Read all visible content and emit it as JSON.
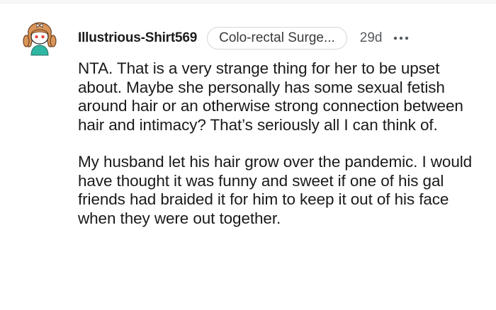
{
  "comment": {
    "author": {
      "username": "Illustrious-Shirt569",
      "avatar_icon": "snoo-avatar-icon",
      "flair": "Colo-rectal Surge..."
    },
    "timestamp": "29d",
    "more_icon": "more-horizontal-icon",
    "paragraphs": [
      "NTA. That is a very strange thing for her to be upset about. Maybe she personally has some sexual fetish around hair or an otherwise strong connection between hair and intimacy? That’s seriously all I can think of.",
      "My husband let his hair grow over the pandemic. I would have thought it was funny and sweet if one of his gal friends had braided it for him to keep it out of his face when they were out together."
    ]
  },
  "colors": {
    "text": "#1a1a1b",
    "meta_text": "#555a5e",
    "flair_border": "#d5d7da",
    "avatar_hair": "#d9955a",
    "avatar_shirt": "#2fb7a3"
  }
}
